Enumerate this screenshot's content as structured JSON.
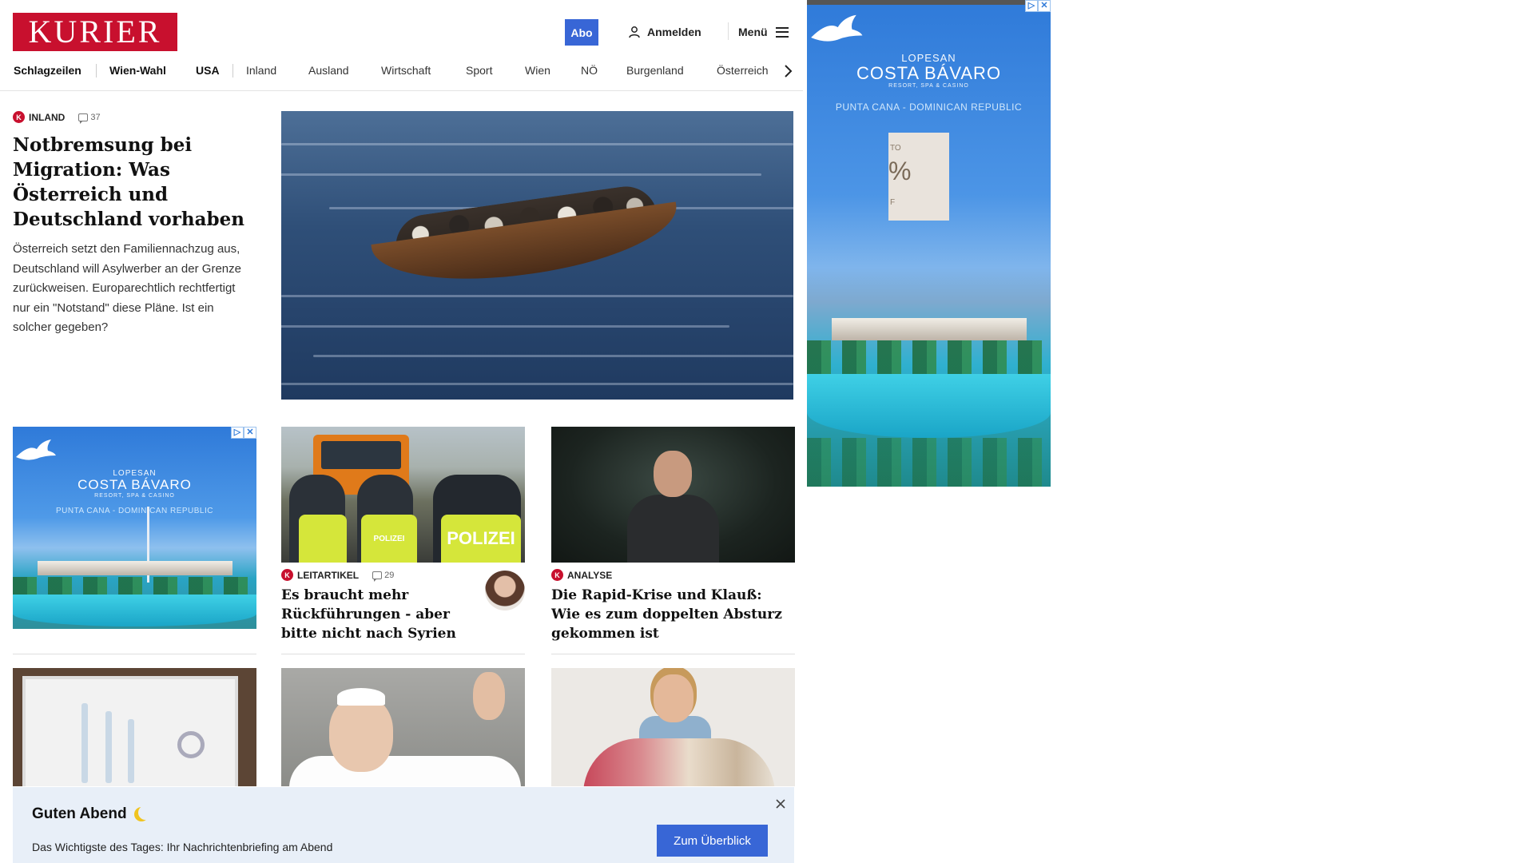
{
  "header": {
    "logo": "KURIER",
    "abo_label": "Abo",
    "login_label": "Anmelden",
    "menu_label": "Menü"
  },
  "nav": {
    "items": [
      {
        "label": "Schlagzeilen"
      },
      {
        "label": "Wien-Wahl"
      },
      {
        "label": "USA"
      },
      {
        "label": "Inland"
      },
      {
        "label": "Ausland"
      },
      {
        "label": "Wirtschaft"
      },
      {
        "label": "Sport"
      },
      {
        "label": "Wien"
      },
      {
        "label": "NÖ"
      },
      {
        "label": "Burgenland"
      },
      {
        "label": "Österreich"
      }
    ]
  },
  "lead": {
    "kicker": "INLAND",
    "comments": "37",
    "title": "Notbremsung bei Migration: Was Österreich und Deutschland vorhaben",
    "teaser": "Österreich setzt den Familiennachzug aus, Deutschland will Asylwerber an der Grenze zurückweisen. Europarechtlich rechtfertigt nur ein \"Notstand\" diese Pläne. Ist ein solcher gegeben?"
  },
  "cards": [
    {
      "kicker": "LEITARTIKEL",
      "comments": "29",
      "title": "Es braucht mehr Rückführungen - aber bitte nicht nach Syrien",
      "vest_text": "POLIZEI"
    },
    {
      "kicker": "ANALYSE",
      "title": "Die Rapid-Krise und Klauß: Wie es zum doppelten Absturz gekommen ist"
    }
  ],
  "ads": {
    "brand_sub": "LOPESAN",
    "brand": "COSTA BÁVARO",
    "brand_tag": "RESORT, SPA & CASINO",
    "location": "PUNTA CANA - DOMINICAN REPUBLIC",
    "promo_top": "TO",
    "promo_percent": "%",
    "promo_bottom": "F",
    "badge_info": "▷",
    "badge_close": "✕"
  },
  "badge_letter": "K",
  "banner": {
    "title": "Guten Abend",
    "text": "Das Wichtigste des Tages: Ihr Nachrichtenbriefing am Abend",
    "button": "Zum Überblick"
  },
  "colors": {
    "brand_red": "#c8102e",
    "accent_blue": "#3866d6",
    "banner_bg": "#e8eff8"
  }
}
